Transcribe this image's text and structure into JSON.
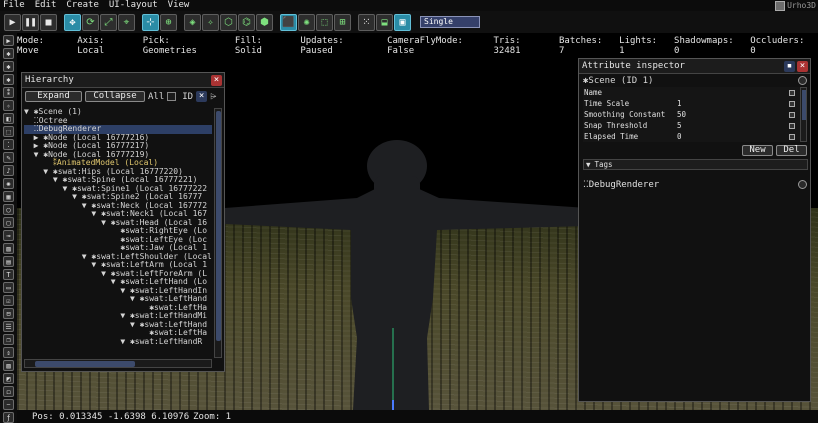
{
  "menu": {
    "file": "File",
    "edit": "Edit",
    "create": "Create",
    "ui_layout": "UI-layout",
    "view": "View"
  },
  "logo": "Urho3D",
  "toolbar": {
    "single_label": "Single"
  },
  "status": {
    "mode": "Mode: Move",
    "axis": "Axis: Local",
    "pick": "Pick: Geometries",
    "fill": "Fill: Solid",
    "updates": "Updates: Paused",
    "camera": "CameraFlyMode: False",
    "tris": "Tris: 32481",
    "batches": "Batches: 7",
    "lights": "Lights: 1",
    "shadowmaps": "Shadowmaps: 0",
    "occluders": "Occluders: 0"
  },
  "hierarchy": {
    "title": "Hierarchy",
    "expand": "Expand",
    "collapse": "Collapse",
    "all": "All",
    "id": "ID",
    "rows": [
      "▼ ✱Scene (1)",
      "  ⁚⁚Octree",
      "  ⁚⁚DebugRenderer",
      "  ▶ ✱Node (Local 16777216)",
      "  ▶ ✱Node (Local 16777217)",
      "  ▼ ✱Node (Local 16777219)",
      "      ⁑AnimatedModel (Local)",
      "    ▼ ✱swat:Hips (Local 16777220)",
      "      ▼ ✱swat:Spine (Local 16777221)",
      "        ▼ ✱swat:Spine1 (Local 16777222",
      "          ▼ ✱swat:Spine2 (Local 16777",
      "            ▼ ✱swat:Neck (Local 167772",
      "              ▼ ✱swat:Neck1 (Local 167",
      "                ▼ ✱swat:Head (Local 16",
      "                    ✱swat:RightEye (Lo",
      "                    ✱swat:LeftEye (Loc",
      "                    ✱swat:Jaw (Local 1",
      "            ▼ ✱swat:LeftShoulder (Local",
      "              ▼ ✱swat:LeftArm (Local 1",
      "                ▼ ✱swat:LeftForeArm (L",
      "                  ▼ ✱swat:LeftHand (Lo",
      "                    ▼ ✱swat:LeftHandIn",
      "                      ▼ ✱swat:LeftHand",
      "                          ✱swat:LeftHa",
      "                    ▼ ✱swat:LeftHandMi",
      "                      ▼ ✱swat:LeftHand",
      "                          ✱swat:LeftHa",
      "                    ▼ ✱swat:LeftHandR"
    ]
  },
  "attributes": {
    "title": "Attribute inspector",
    "scene": "Scene (ID 1)",
    "rows": [
      {
        "k": "Name",
        "v": ""
      },
      {
        "k": "Time Scale",
        "v": "1"
      },
      {
        "k": "Smoothing Constant",
        "v": "50"
      },
      {
        "k": "Snap Threshold",
        "v": "5"
      },
      {
        "k": "Elapsed Time",
        "v": "0"
      }
    ],
    "new": "New",
    "del": "Del",
    "tags": "Tags",
    "debug_renderer": "DebugRenderer"
  },
  "bottom": {
    "pos": "Pos: 0.013345 -1.6398 6.10976",
    "zoom": "Zoom: 1"
  }
}
